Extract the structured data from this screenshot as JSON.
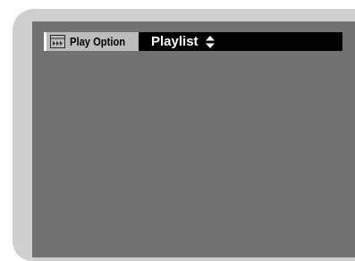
{
  "menu": {
    "label": "Play Option",
    "label_icon": "play-option-icon",
    "value": "Playlist",
    "value_icon": "up-down-arrows-icon"
  },
  "colors": {
    "display_background": "#727272",
    "bezel": "#cfcfcf",
    "label_box": "#bcbcbc",
    "value_bar": "#000000",
    "value_text": "#ffffff"
  }
}
